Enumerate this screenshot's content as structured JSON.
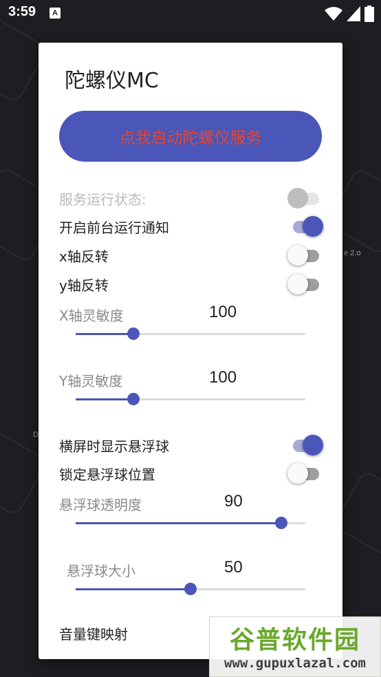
{
  "status_bar": {
    "time": "3:59",
    "notification_icon": "a-letter-icon",
    "icons": [
      "wifi-icon",
      "signal-icon",
      "battery-icon"
    ]
  },
  "background": {
    "side_text": "e 2.o",
    "side_text_2": "D"
  },
  "dialog": {
    "title": "陀螺仪MC",
    "start_button": "点我启动陀螺仪服务",
    "rows": [
      {
        "label": "服务运行状态:",
        "state": "off",
        "enabled": false
      },
      {
        "label": "开启前台运行通知",
        "state": "on",
        "enabled": true
      },
      {
        "label": "x轴反转",
        "state": "off",
        "enabled": true
      },
      {
        "label": "y轴反转",
        "state": "off",
        "enabled": true
      }
    ],
    "sliders": [
      {
        "label": "X轴灵敏度",
        "value": "100",
        "fraction": 0.25
      },
      {
        "label": "Y轴灵敏度",
        "value": "100",
        "fraction": 0.25
      },
      {
        "label": "悬浮球透明度",
        "value": "90",
        "fraction": 0.895
      },
      {
        "label": "悬浮球大小",
        "value": "50",
        "fraction": 0.5
      }
    ],
    "float_rows": [
      {
        "label": "横屏时显示悬浮球",
        "state": "on",
        "enabled": true
      },
      {
        "label": "锁定悬浮球位置",
        "state": "off",
        "enabled": true
      }
    ],
    "volume_label": "音量键映射"
  },
  "watermark": {
    "top": "谷普软件园",
    "bottom": "www.gupuxlazal.com"
  },
  "colors": {
    "accent": "#4a56b8",
    "button_text": "#e8452e"
  }
}
